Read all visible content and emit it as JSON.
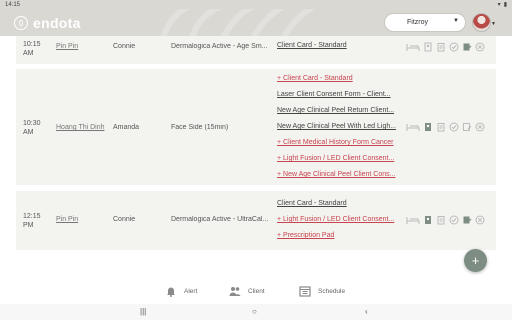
{
  "statusbar": {
    "time": "14:15"
  },
  "header": {
    "logo": "endota",
    "location": "Fitzroy"
  },
  "appointments": [
    {
      "time": "10:15 AM",
      "client": "Pin Pin",
      "staff": "Connie",
      "service": "Dermalogica Active - Age Sm...",
      "forms": [
        {
          "label": "Client Card - Standard",
          "style": "dark"
        }
      ]
    },
    {
      "time": "10:30 AM",
      "client": "Hoang Thi Dinh",
      "staff": "Amanda",
      "service": "Face Side (15min)",
      "forms": [
        {
          "label": "+ Client Card - Standard",
          "style": "red"
        },
        {
          "label": "Laser Client Consent Form - Client...",
          "style": "dark"
        },
        {
          "label": "New Age Clinical Peel Return Client...",
          "style": "dark"
        },
        {
          "label": "New Age Clinical Peel With Led Ligh...",
          "style": "dark"
        },
        {
          "label": "+ Client Medical History Form Cancer",
          "style": "red"
        },
        {
          "label": "+ Light Fusion / LED Client Consent...",
          "style": "red"
        },
        {
          "label": "+ New Age Clinical Peel Client Cons...",
          "style": "red"
        }
      ]
    },
    {
      "time": "12:15 PM",
      "client": "Pin Pin",
      "staff": "Connie",
      "service": "Dermalogica Active - UltraCal...",
      "forms": [
        {
          "label": "Client Card - Standard",
          "style": "dark"
        },
        {
          "label": "+ Light Fusion / LED Client Consent...",
          "style": "red"
        },
        {
          "label": "+ Prescription Pad",
          "style": "red"
        }
      ]
    }
  ],
  "fab": {
    "label": "+"
  },
  "bottom_nav": {
    "alert": "Alert",
    "client": "Client",
    "schedule": "Schedule"
  },
  "colors": {
    "header_bg": "#d9d8d2",
    "accent_red": "#c8444e",
    "fab": "#7e8d83"
  }
}
